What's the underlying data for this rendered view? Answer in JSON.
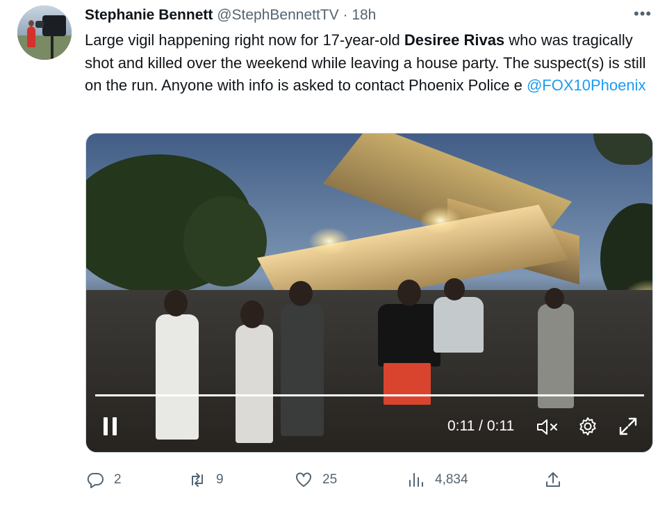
{
  "author": {
    "name": "Stephanie Bennett",
    "handle": "@StephBennettTV",
    "separator": "·",
    "time": "18h"
  },
  "tweet": {
    "text_1": "Large vigil happening right now for 17-year-old ",
    "bold_name": "Desiree Rivas",
    "text_2": " who was tragically shot and killed over the weekend while leaving a house party. The suspect(s) is still on the run. Anyone with info is asked to contact Phoenix Police e ",
    "mention": "@FOX10Phoenix"
  },
  "video": {
    "timecode": "0:11 / 0:11",
    "progress": 1.0
  },
  "actions": {
    "replies": "2",
    "retweets": "9",
    "likes": "25",
    "views": "4,834"
  },
  "colors": {
    "accent": "#1d9bf0",
    "muted": "#536471",
    "text": "#0f1419"
  },
  "icons": {
    "more": "more-icon",
    "pause": "pause-icon",
    "mute": "mute-icon",
    "settings": "gear-icon",
    "fullscreen": "expand-icon",
    "reply": "reply-icon",
    "retweet": "retweet-icon",
    "like": "heart-icon",
    "views": "views-icon",
    "share": "share-icon"
  }
}
